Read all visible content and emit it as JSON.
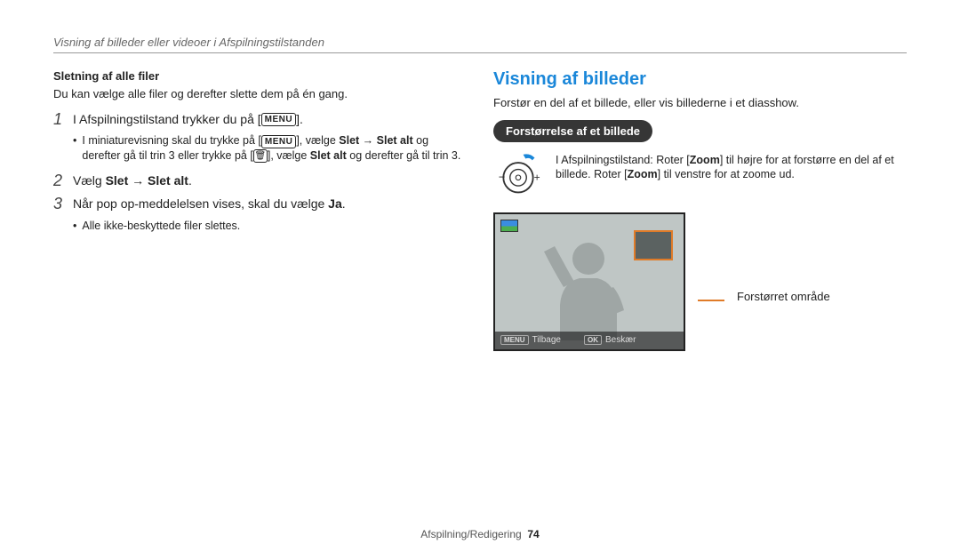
{
  "breadcrumb": "Visning af billeder eller videoer i Afspilningstilstanden",
  "left": {
    "heading": "Sletning af alle filer",
    "intro": "Du kan vælge alle filer og derefter slette dem på én gang.",
    "menu_label": "MENU",
    "step1_pre": "I Afspilningstilstand trykker du på [",
    "step1_post": "].",
    "bullet1a_pre": "I miniaturevisning skal du trykke på [",
    "bullet1a_mid": "], vælge ",
    "bullet1a_bold1": "Slet",
    "bullet1a_arrow": " → ",
    "bullet1a_bold2": "Slet alt",
    "bullet1a_cont": " og derefter gå til trin 3 eller trykke på [",
    "bullet1a_post": "], vælge ",
    "bullet1a_bold3": "Slet alt",
    "bullet1a_end": " og derefter gå til trin 3.",
    "step2_pre": "Vælg ",
    "step2_bold1": "Slet",
    "step2_arrow": " → ",
    "step2_bold2": "Slet alt",
    "step2_post": ".",
    "step3_pre": "Når pop op-meddelelsen vises, skal du vælge ",
    "step3_bold": "Ja",
    "step3_post": ".",
    "bullet3": "Alle ikke-beskyttede filer slettes."
  },
  "right": {
    "section_title": "Visning af billeder",
    "intro": "Forstør en del af et billede, eller vis billederne i et diasshow.",
    "pill": "Forstørrelse af et billede",
    "zoom_pre": "I Afspilningstilstand: Roter [",
    "zoom_bold1": "Zoom",
    "zoom_mid": "] til højre for at forstørre en del af et billede. Roter [",
    "zoom_bold2": "Zoom",
    "zoom_post": "] til venstre for at zoome ud.",
    "bar_menu": "MENU",
    "bar_back": "Tilbage",
    "bar_ok": "OK",
    "bar_crop": "Beskær",
    "callout": "Forstørret område"
  },
  "footer": {
    "section": "Afspilning/Redigering",
    "page": "74"
  }
}
